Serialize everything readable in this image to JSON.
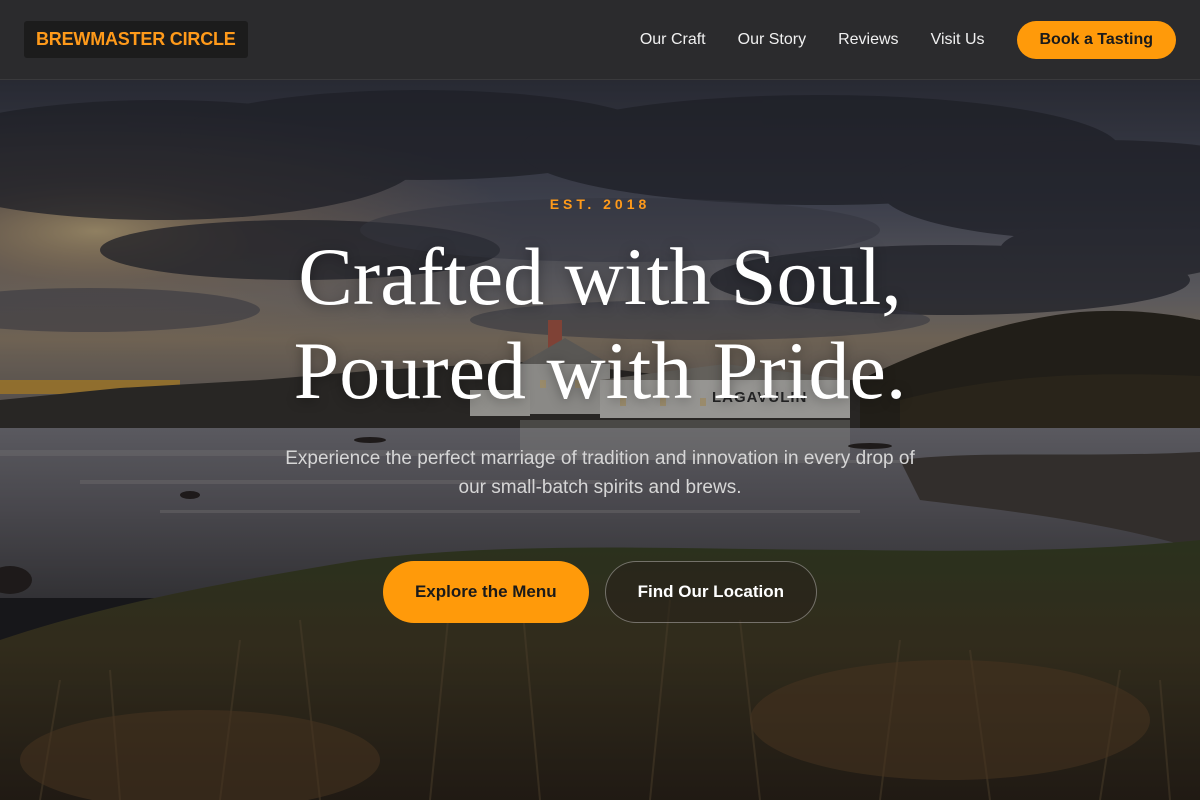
{
  "nav": {
    "logo": "BREWMASTER CIRCLE",
    "links": [
      "Our Craft",
      "Our Story",
      "Reviews",
      "Visit Us"
    ],
    "cta": "Book a Tasting"
  },
  "hero": {
    "eyebrow": "EST. 2018",
    "headline_line1": "Crafted with Soul,",
    "headline_line2": "Poured with Pride.",
    "subtext": "Experience the perfect marriage of tradition and innovation in every drop of our small-batch spirits and brews.",
    "primary_button": "Explore the Menu",
    "secondary_button": "Find Our Location",
    "background_image": "dusk-coastal-distillery-landscape",
    "building_sign": "LAGAVULIN"
  },
  "colors": {
    "accent": "#ff9a0a",
    "nav_bg": "#2b2b2d",
    "logo_bg": "#1c1c1c",
    "text_light": "#ffffff"
  }
}
